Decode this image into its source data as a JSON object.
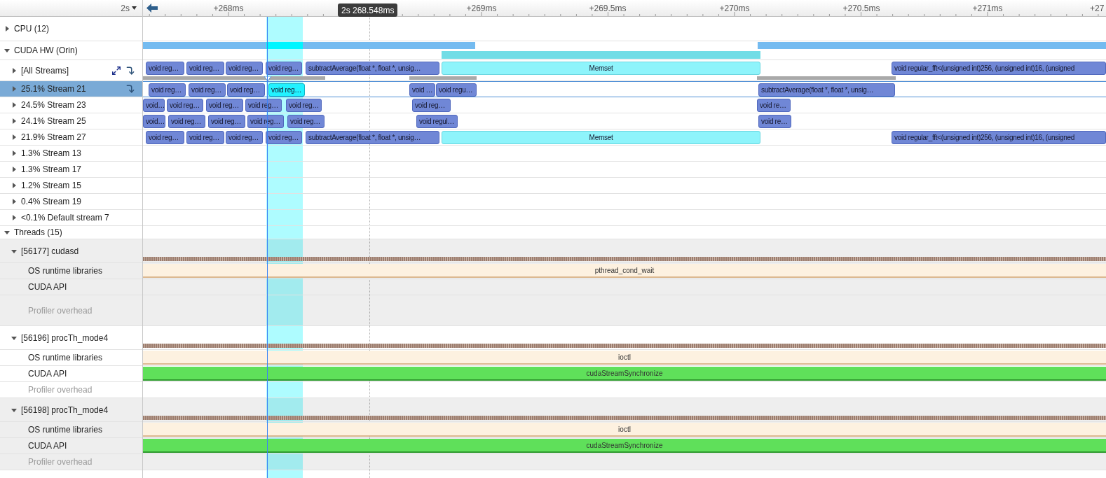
{
  "ruler": {
    "range": "2s",
    "labels": [
      "+268ms",
      "+269ms",
      "+269.5ms",
      "+270ms",
      "+270.5ms",
      "+271ms",
      "+27"
    ],
    "cursor_time": "2s 268.548ms"
  },
  "rows": [
    {
      "kind": "group",
      "label": "CPU (12)",
      "expanded": false
    },
    {
      "kind": "group",
      "label": "CUDA HW (Orin)",
      "expanded": true,
      "children": [
        {
          "kind": "streams",
          "label": "[All Streams]",
          "expanded": false,
          "selected": false,
          "events": [
            {
              "label": "void reg…",
              "kind": "kernel",
              "selected": false
            },
            {
              "label": "void reg…",
              "kind": "kernel",
              "selected": false
            },
            {
              "label": "void reg…",
              "kind": "kernel",
              "selected": false
            },
            {
              "label": "void reg…",
              "kind": "kernel",
              "selected": false
            },
            {
              "label": "subtractAverage(float *, float *, unsig…",
              "kind": "kernel",
              "selected": false
            },
            {
              "label": "Memset",
              "kind": "memset",
              "selected": false
            },
            {
              "label": "void regular_fft<(unsigned int)256, (unsigned int)16, (unsigned",
              "kind": "kernel",
              "selected": false
            }
          ]
        },
        {
          "kind": "stream",
          "label": "25.1% Stream 21",
          "expanded": false,
          "selected": true,
          "events": [
            {
              "label": "void reg…",
              "kind": "kernel",
              "selected": false
            },
            {
              "label": "void reg…",
              "kind": "kernel",
              "selected": false
            },
            {
              "label": "void reg…",
              "kind": "kernel",
              "selected": false
            },
            {
              "label": "void reg…",
              "kind": "kernel",
              "selected": true
            },
            {
              "label": "void …",
              "kind": "kernel",
              "selected": false
            },
            {
              "label": "void regu…",
              "kind": "kernel",
              "selected": false
            },
            {
              "label": "subtractAverage(float *, float *, unsig…",
              "kind": "kernel",
              "selected": false
            }
          ]
        },
        {
          "kind": "stream",
          "label": "24.5% Stream 23",
          "expanded": false,
          "selected": false,
          "events": [
            {
              "label": "void…",
              "kind": "kernel",
              "selected": false
            },
            {
              "label": "void reg…",
              "kind": "kernel",
              "selected": false
            },
            {
              "label": "void reg…",
              "kind": "kernel",
              "selected": false
            },
            {
              "label": "void reg…",
              "kind": "kernel",
              "selected": false
            },
            {
              "label": "void reg…",
              "kind": "kernel",
              "selected": false
            },
            {
              "label": "void reg…",
              "kind": "kernel",
              "selected": false
            },
            {
              "label": "void re…",
              "kind": "kernel",
              "selected": false
            }
          ]
        },
        {
          "kind": "stream",
          "label": "24.1% Stream 25",
          "expanded": false,
          "selected": false,
          "events": [
            {
              "label": "void…",
              "kind": "kernel",
              "selected": false
            },
            {
              "label": "void reg…",
              "kind": "kernel",
              "selected": false
            },
            {
              "label": "void reg…",
              "kind": "kernel",
              "selected": false
            },
            {
              "label": "void reg…",
              "kind": "kernel",
              "selected": false
            },
            {
              "label": "void reg…",
              "kind": "kernel",
              "selected": false
            },
            {
              "label": "void regul…",
              "kind": "kernel",
              "selected": false
            },
            {
              "label": "void re…",
              "kind": "kernel",
              "selected": false
            }
          ]
        },
        {
          "kind": "stream",
          "label": "21.9% Stream 27",
          "expanded": false,
          "selected": false,
          "events": [
            {
              "label": "void reg…",
              "kind": "kernel",
              "selected": false
            },
            {
              "label": "void reg…",
              "kind": "kernel",
              "selected": false
            },
            {
              "label": "void reg…",
              "kind": "kernel",
              "selected": false
            },
            {
              "label": "void reg…",
              "kind": "kernel",
              "selected": false
            },
            {
              "label": "subtractAverage(float *, float *, unsig…",
              "kind": "kernel",
              "selected": false
            },
            {
              "label": "Memset",
              "kind": "memset",
              "selected": false
            },
            {
              "label": "void regular_fft<(unsigned int)256, (unsigned int)16, (unsigned",
              "kind": "kernel",
              "selected": false
            }
          ]
        },
        {
          "kind": "stream",
          "label": "1.3% Stream 13",
          "expanded": false,
          "selected": false
        },
        {
          "kind": "stream",
          "label": "1.3% Stream 17",
          "expanded": false,
          "selected": false
        },
        {
          "kind": "stream",
          "label": "1.2% Stream 15",
          "expanded": false,
          "selected": false
        },
        {
          "kind": "stream",
          "label": "0.4% Stream 19",
          "expanded": false,
          "selected": false
        },
        {
          "kind": "stream",
          "label": "<0.1% Default stream 7",
          "expanded": false,
          "selected": false
        }
      ]
    },
    {
      "kind": "group",
      "label": "Threads (15)",
      "expanded": true,
      "children": [
        {
          "kind": "thread",
          "label": "[56177] cudasd",
          "expanded": true,
          "children": [
            {
              "kind": "lane",
              "label": "OS runtime libraries",
              "dimmed": false,
              "bar": {
                "kind": "os",
                "label": "pthread_cond_wait"
              }
            },
            {
              "kind": "lane",
              "label": "CUDA API",
              "dimmed": false
            },
            {
              "kind": "lane",
              "label": "Profiler overhead",
              "dimmed": true
            }
          ]
        },
        {
          "kind": "thread",
          "label": "[56196] procTh_mode4",
          "expanded": true,
          "children": [
            {
              "kind": "lane",
              "label": "OS runtime libraries",
              "dimmed": false,
              "bar": {
                "kind": "os",
                "label": "ioctl"
              }
            },
            {
              "kind": "lane",
              "label": "CUDA API",
              "dimmed": false,
              "bar": {
                "kind": "cuda",
                "label": "cudaStreamSynchronize"
              }
            },
            {
              "kind": "lane",
              "label": "Profiler overhead",
              "dimmed": true
            }
          ]
        },
        {
          "kind": "thread",
          "label": "[56198] procTh_mode4",
          "expanded": true,
          "children": [
            {
              "kind": "lane",
              "label": "OS runtime libraries",
              "dimmed": false,
              "bar": {
                "kind": "os",
                "label": "ioctl"
              }
            },
            {
              "kind": "lane",
              "label": "CUDA API",
              "dimmed": false,
              "bar": {
                "kind": "cuda",
                "label": "cudaStreamSynchronize"
              }
            },
            {
              "kind": "lane",
              "label": "Profiler overhead",
              "dimmed": true
            }
          ]
        }
      ]
    }
  ]
}
